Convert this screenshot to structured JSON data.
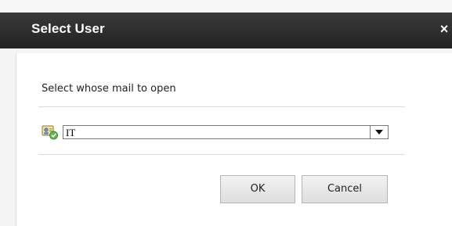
{
  "dialog": {
    "title": "Select User",
    "close_glyph": "×",
    "prompt": "Select whose mail to open",
    "select": {
      "value": "IT",
      "icon": "user-contact-icon"
    },
    "buttons": {
      "ok": "OK",
      "cancel": "Cancel"
    }
  },
  "colors": {
    "titlebar": "#2b2b2b",
    "title_text": "#ffffff",
    "dialog_background": "#ffffff",
    "page_background": "#f4f4f4"
  }
}
